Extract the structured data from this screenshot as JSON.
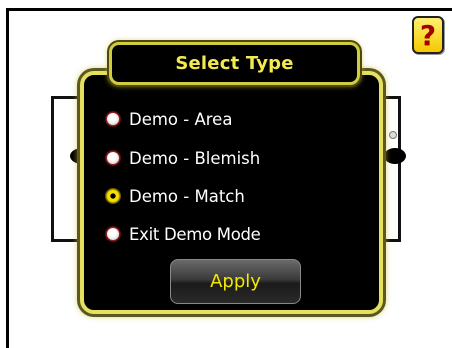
{
  "help": {
    "glyph": "?"
  },
  "dialog": {
    "title": "Select Type",
    "options": [
      {
        "label": "Demo - Area",
        "selected": false
      },
      {
        "label": "Demo - Blemish",
        "selected": false
      },
      {
        "label": "Demo - Match",
        "selected": true
      },
      {
        "label": "Exit Demo Mode",
        "selected": false
      }
    ],
    "apply_label": "Apply"
  },
  "colors": {
    "accent": "#f2ea50",
    "dialog_bg": "#000000",
    "radio_selected": "#f5e000",
    "help_bg": "#f5c800"
  }
}
